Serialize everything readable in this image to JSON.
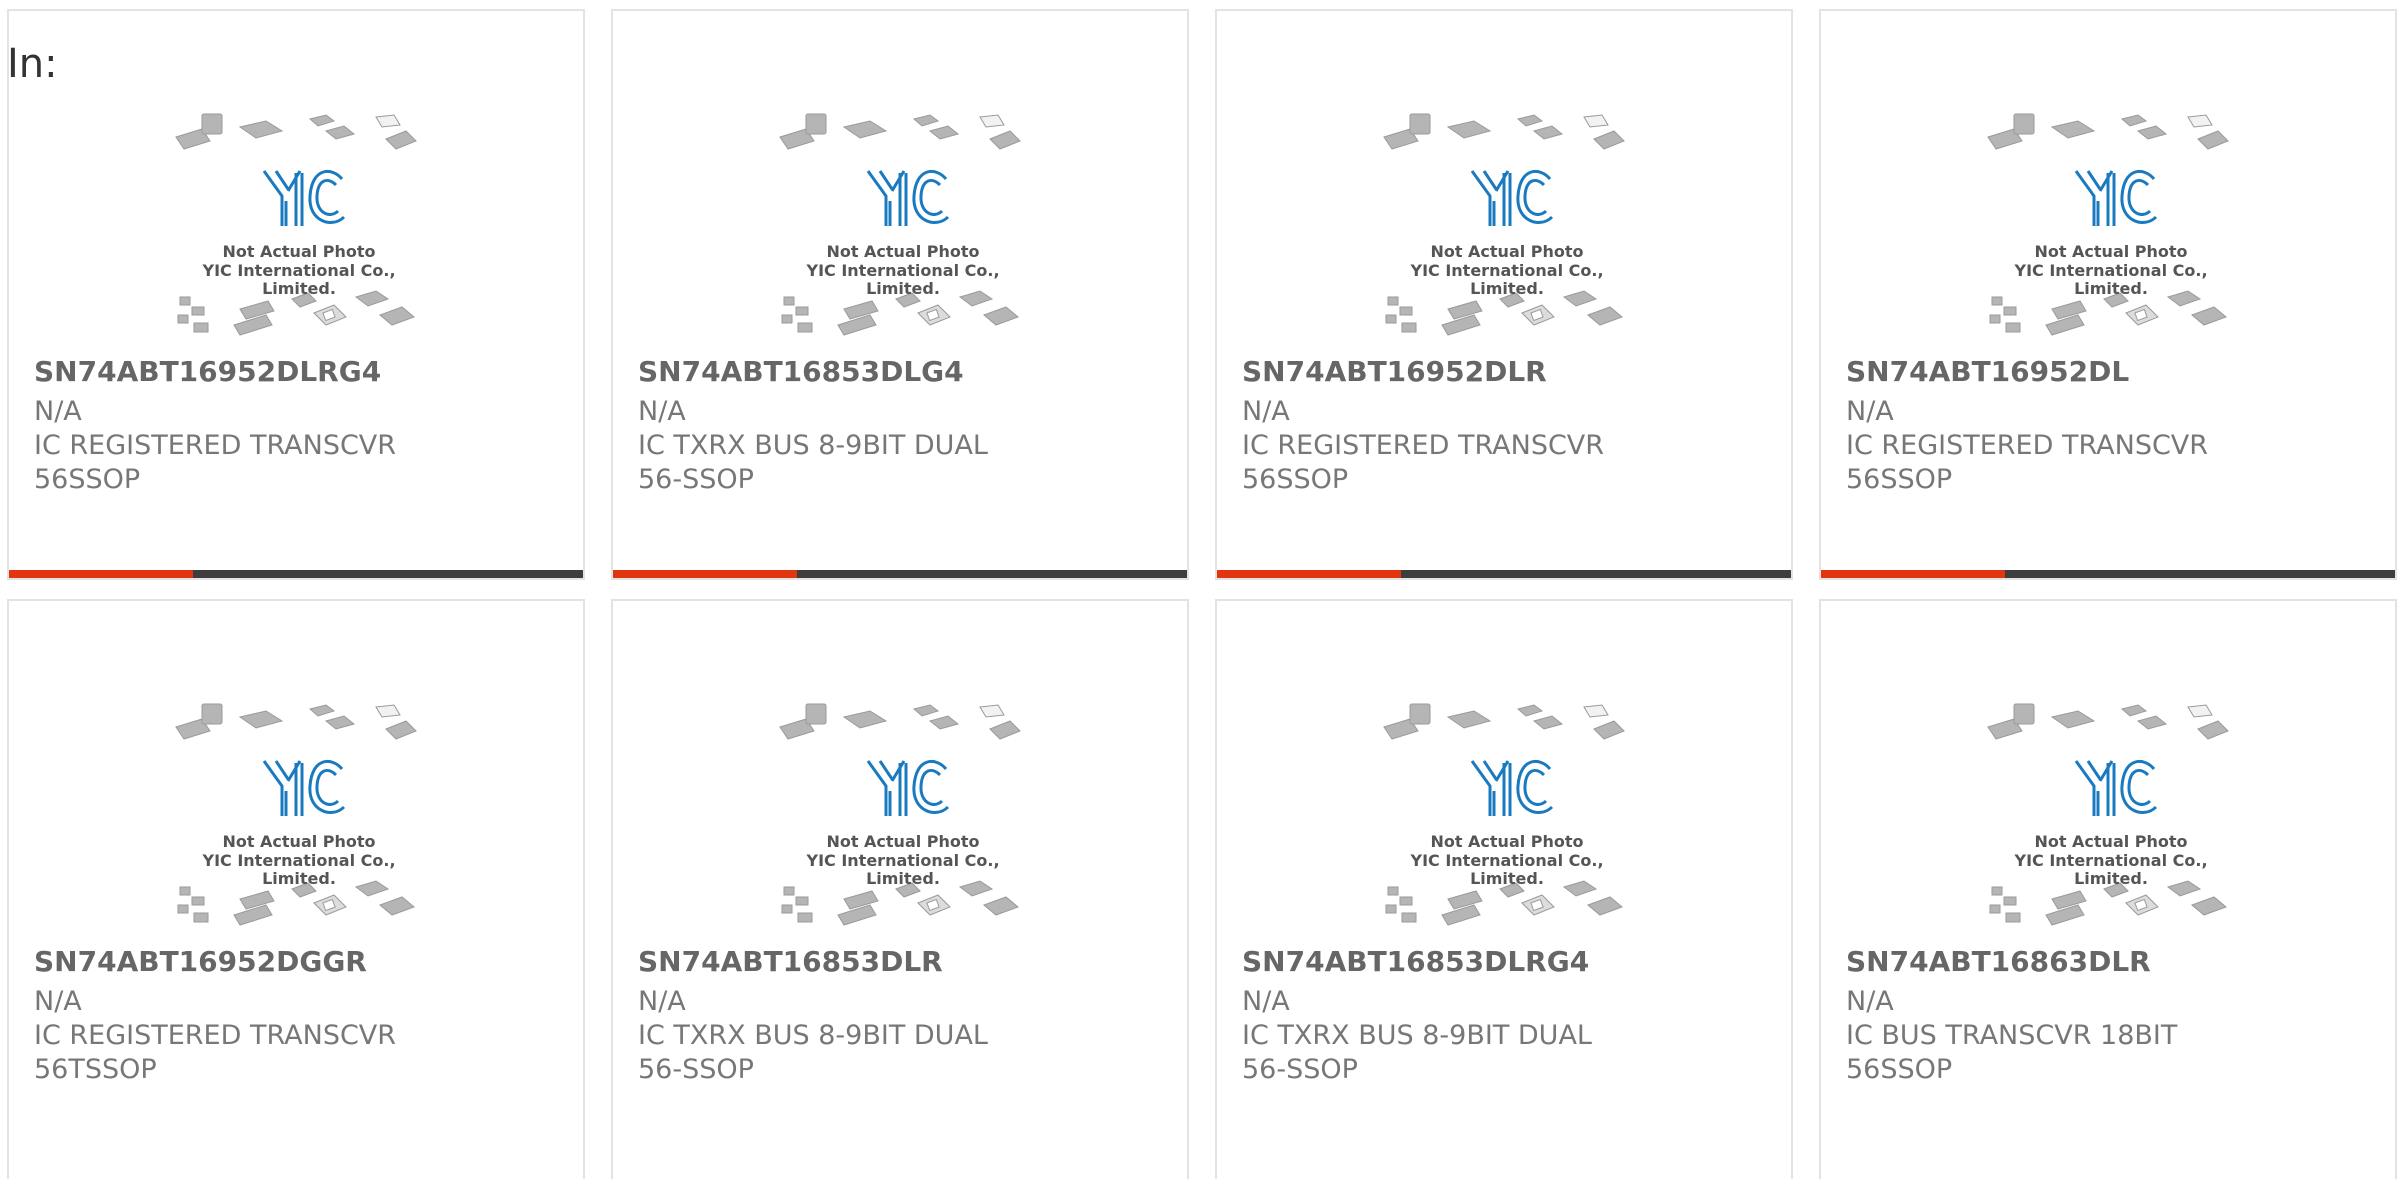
{
  "page": {
    "in_label": "In:"
  },
  "photo": {
    "caption_line1": "Not Actual Photo",
    "caption_line2": "YIC International Co., Limited."
  },
  "colors": {
    "accent": "#e2360f",
    "bar": "#3d3d3d",
    "logo": "#1a7ac0",
    "chip": "#b5b5b5"
  },
  "products": [
    {
      "part_number": "SN74ABT16952DLRG4",
      "manufacturer": "N/A",
      "description": "IC REGISTERED TRANSCVR 56SSOP"
    },
    {
      "part_number": "SN74ABT16853DLG4",
      "manufacturer": "N/A",
      "description": "IC TXRX BUS 8-9BIT DUAL 56-SSOP"
    },
    {
      "part_number": "SN74ABT16952DLR",
      "manufacturer": "N/A",
      "description": "IC REGISTERED TRANSCVR 56SSOP"
    },
    {
      "part_number": "SN74ABT16952DL",
      "manufacturer": "N/A",
      "description": "IC REGISTERED TRANSCVR 56SSOP"
    },
    {
      "part_number": "SN74ABT16952DGGR",
      "manufacturer": "N/A",
      "description": "IC REGISTERED TRANSCVR 56TSSOP"
    },
    {
      "part_number": "SN74ABT16853DLR",
      "manufacturer": "N/A",
      "description": "IC TXRX BUS 8-9BIT DUAL 56-SSOP"
    },
    {
      "part_number": "SN74ABT16853DLRG4",
      "manufacturer": "N/A",
      "description": "IC TXRX BUS 8-9BIT DUAL 56-SSOP"
    },
    {
      "part_number": "SN74ABT16863DLR",
      "manufacturer": "N/A",
      "description": "IC BUS TRANSCVR 18BIT 56SSOP"
    }
  ]
}
